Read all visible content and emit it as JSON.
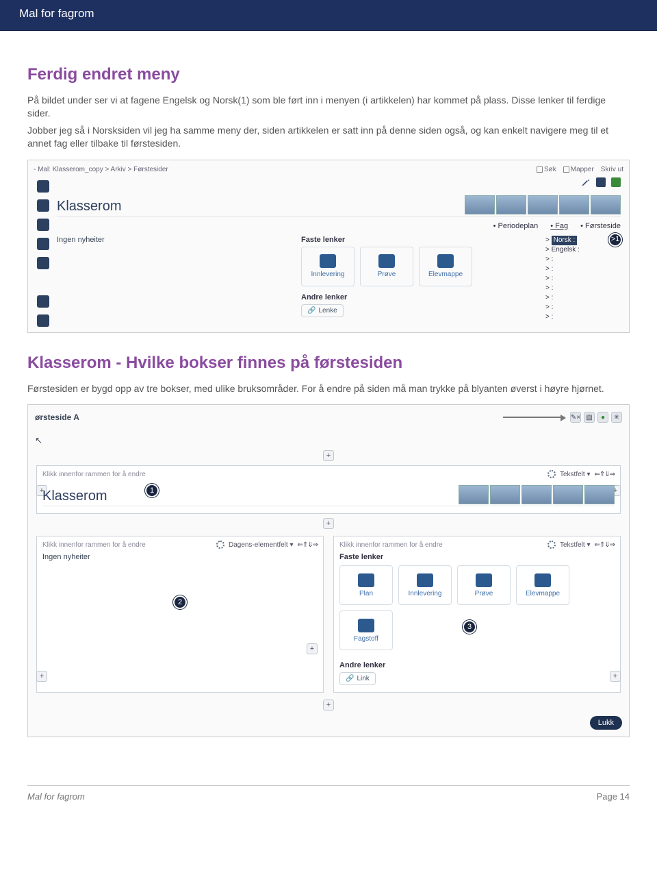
{
  "topbar": {
    "title": "Mal for fagrom"
  },
  "section1": {
    "heading": "Ferdig endret meny",
    "p1": "På bildet under ser vi at fagene Engelsk og Norsk(1) som ble ført inn i menyen (i artikkelen) har kommet på plass. Disse lenker til ferdige sider.",
    "p2": "Jobber jeg så i Norsksiden vil jeg ha samme meny der, siden artikkelen er satt inn på denne siden også, og kan enkelt navigere meg til et annet fag eller tilbake til førstesiden."
  },
  "shot1": {
    "breadcrumb": "- Mal: Klasserom_copy > Arkiv > Førstesider",
    "tools": {
      "sok": "Søk",
      "mapper": "Mapper",
      "skrivut": "Skriv ut"
    },
    "title": "Klasserom",
    "tabs": {
      "periodeplan": "Periodeplan",
      "fag": "Fag",
      "forsteside": "Førsteside"
    },
    "nyheter": "Ingen nyheiter",
    "faste": "Faste lenker",
    "cells": {
      "innlevering": "Innlevering",
      "prove": "Prøve",
      "elevmappe": "Elevmappe"
    },
    "andre": "Andre lenker",
    "lenke": "Lenke",
    "flyout": {
      "norsk": "Norsk :",
      "engelsk": "Engelsk :",
      "blank": ":"
    },
    "badge1": "1"
  },
  "section2": {
    "heading": "Klasserom - Hvilke bokser finnes på førstesiden",
    "p1": "Førstesiden er bygd opp av tre bokser, med ulike bruksområder. For å endre på siden må man trykke på blyanten øverst i høyre hjørnet."
  },
  "shot2": {
    "title": "ørsteside A",
    "toolbar": {
      "pencil_x": "✎×"
    },
    "panel_hint": "Klikk innenfor rammen for å endre",
    "tekstfelt": "Tekstfelt ▾",
    "dagens": "Dagens-elementfelt ▾",
    "klasserom": "Klasserom",
    "nyheter": "Ingen nyheiter",
    "faste": "Faste lenker",
    "cells": {
      "plan": "Plan",
      "innlevering": "Innlevering",
      "prove": "Prøve",
      "elevmappe": "Elevmappe",
      "fagstoff": "Fagstoff"
    },
    "andre": "Andre lenker",
    "link": "Link",
    "lukk": "Lukk",
    "badges": {
      "b1": "1",
      "b2": "2",
      "b3": "3"
    }
  },
  "footer": {
    "left": "Mal for fagrom",
    "right": "Page 14"
  }
}
